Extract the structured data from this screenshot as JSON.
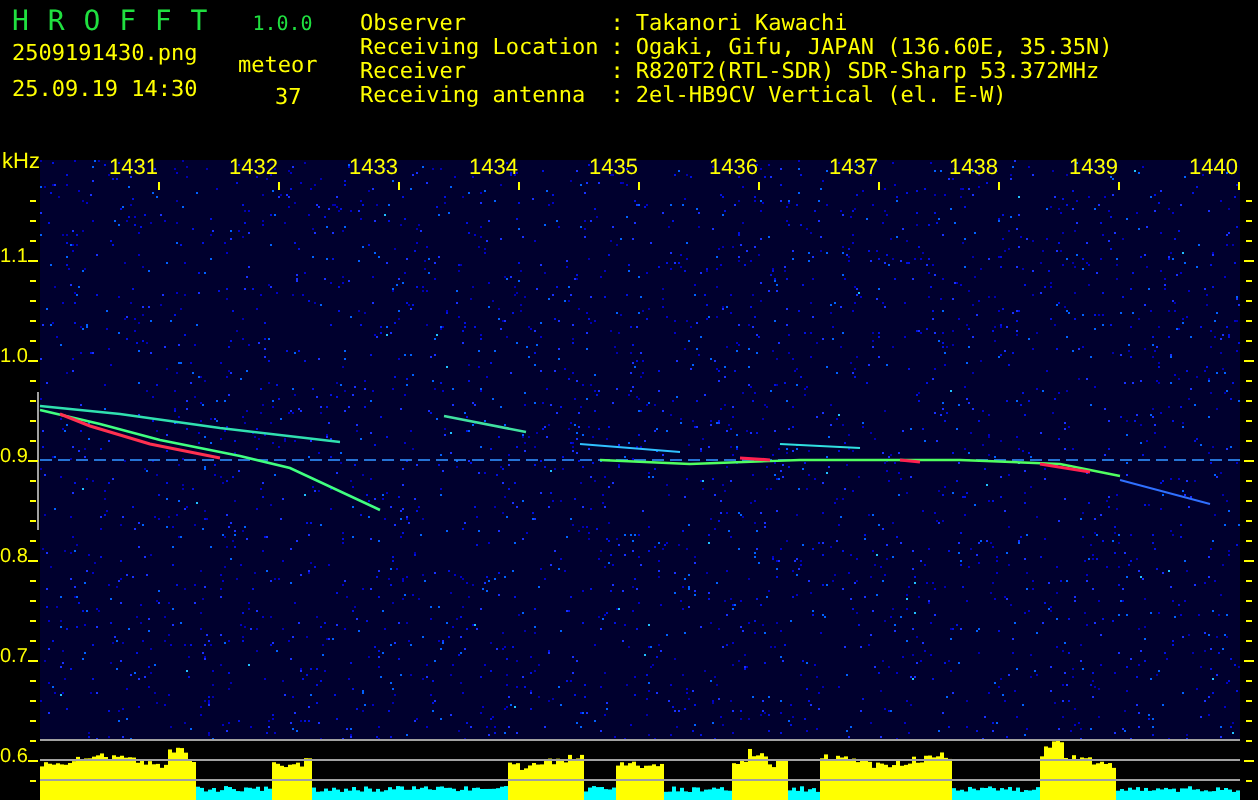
{
  "app": {
    "name": "H R O F F T",
    "version": "1.0.0"
  },
  "file": {
    "name": "2509191430.png",
    "datetime": "25.09.19 14:30"
  },
  "counter": {
    "label": "meteor",
    "value": "37"
  },
  "info": [
    {
      "label": "Observer",
      "separator": ":",
      "value": "Takanori Kawachi"
    },
    {
      "label": "Receiving Location",
      "separator": ":",
      "value": "Ogaki, Gifu, JAPAN (136.60E, 35.35N)"
    },
    {
      "label": "Receiver",
      "separator": ":",
      "value": "R820T2(RTL-SDR) SDR-Sharp 53.372MHz"
    },
    {
      "label": "Receiving antenna",
      "separator": ":",
      "value": "2el-HB9CV Vertical (el. E-W)"
    }
  ],
  "plot": {
    "unit": "kHz",
    "x_ticks": [
      "1431",
      "1432",
      "1433",
      "1434",
      "1435",
      "1436",
      "1437",
      "1438",
      "1439",
      "1440"
    ],
    "y_ticks": [
      "1.1",
      "1.0",
      "0.9",
      "0.8",
      "0.7",
      "0.6"
    ]
  }
}
